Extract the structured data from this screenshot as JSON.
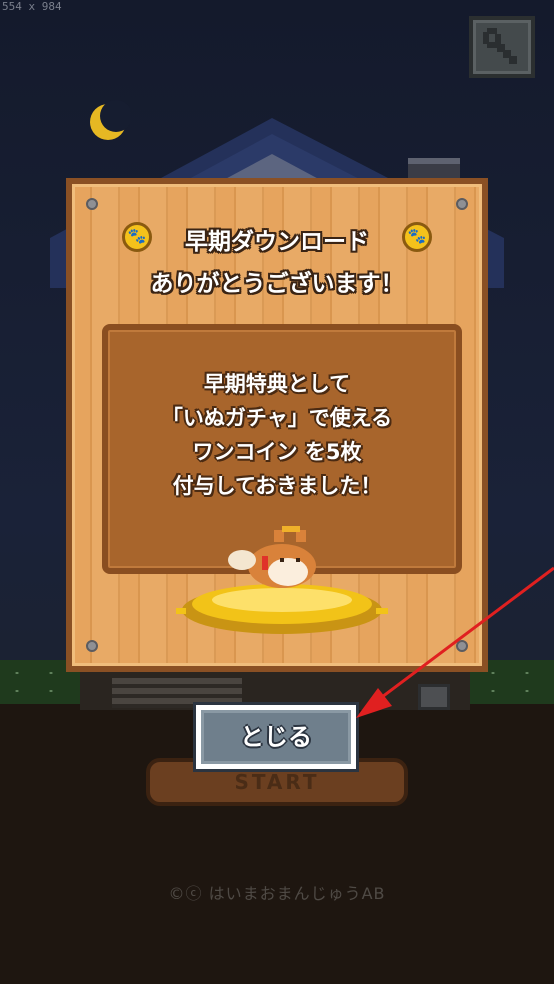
{
  "overlay": {
    "dimension_label": "554 x 984"
  },
  "dialog": {
    "title_line1": "早期ダウンロード",
    "title_line2": "ありがとうございます！",
    "body_lines": [
      "早期特典として",
      "「いぬガチャ」で使える",
      "ワンコイン を5枚",
      "付与しておきました！"
    ],
    "coin_icon": "paw-coin-icon"
  },
  "close_button": {
    "label": "とじる"
  },
  "start_button": {
    "label": "START"
  },
  "footer": {
    "copyright": "©ⓒ はいまおまんじゅうAB"
  },
  "icons": {
    "settings": "wrench-icon"
  },
  "colors": {
    "wood": "#e6a45e",
    "panel": "#a8652c",
    "close_button": "#6f7f8c",
    "arrow": "#e02020"
  }
}
